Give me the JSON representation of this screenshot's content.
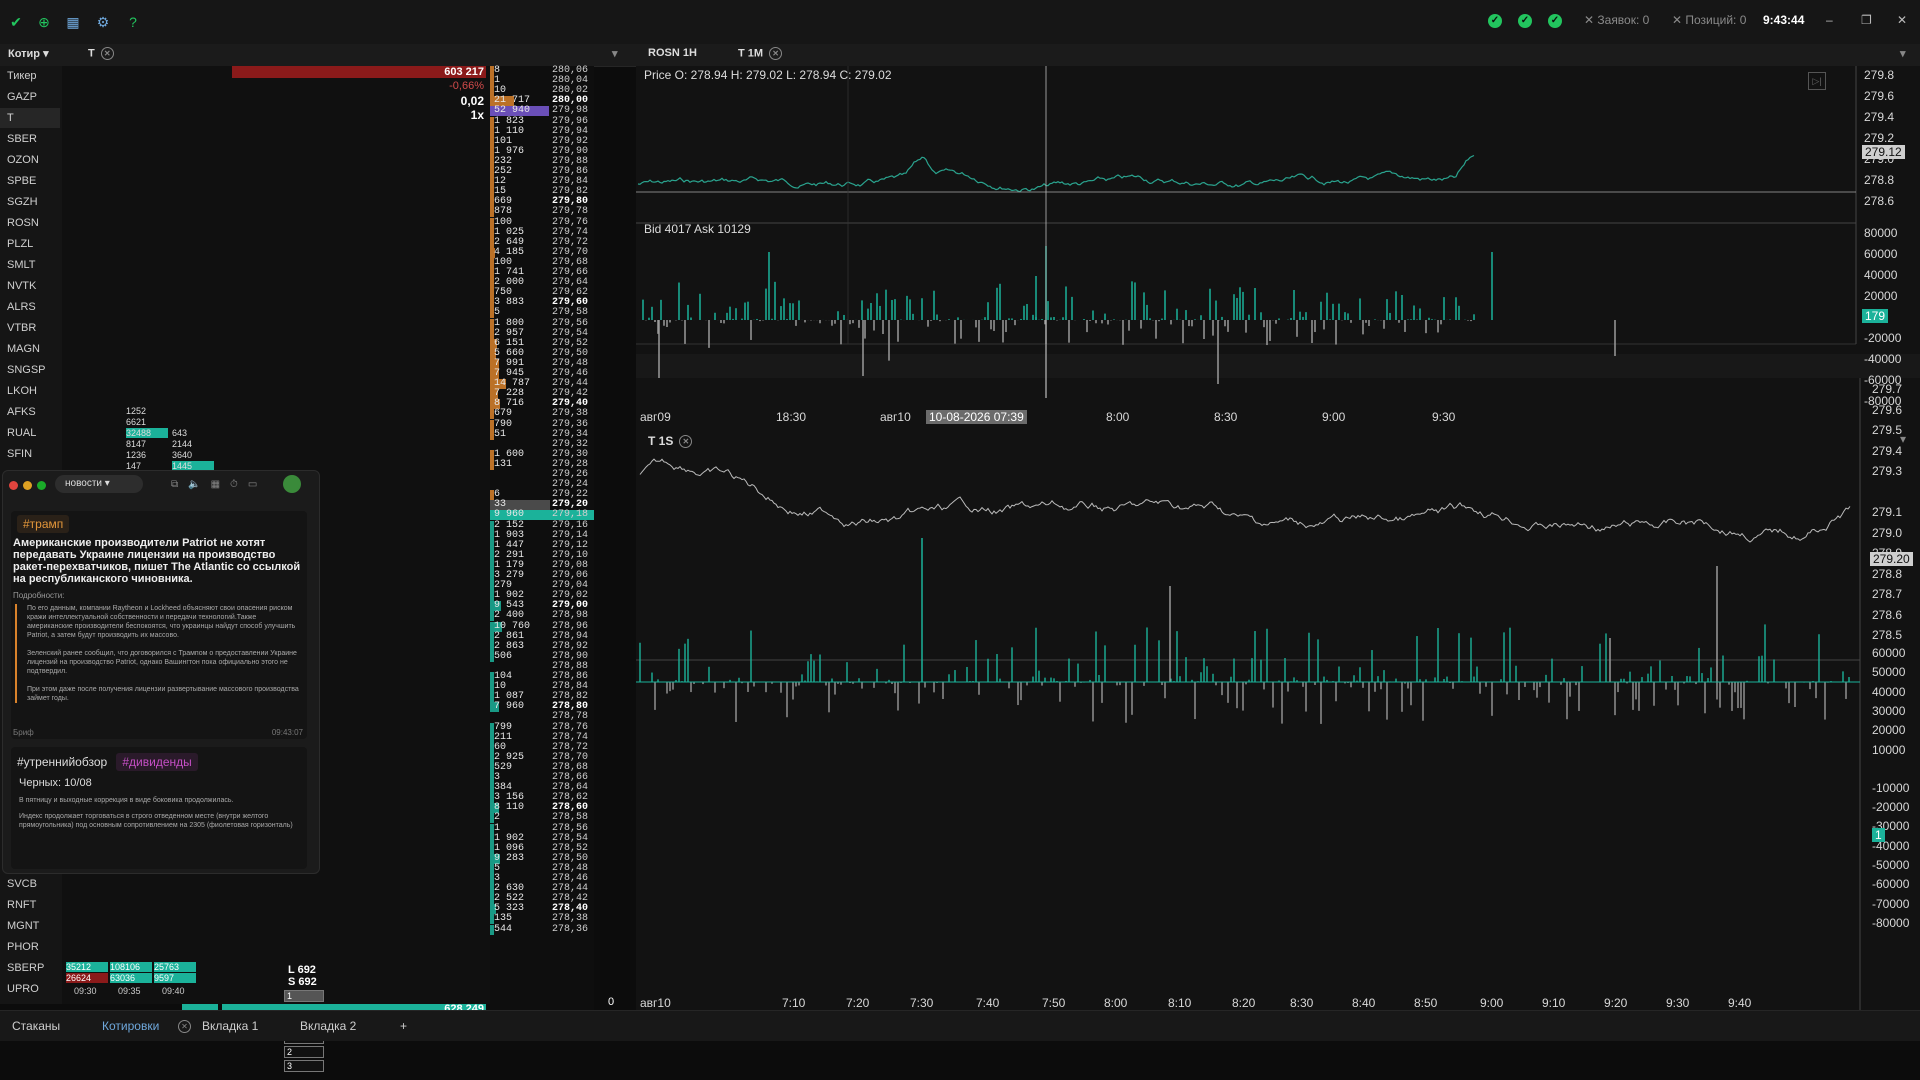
{
  "topbar": {
    "zayavok": "Заявок: 0",
    "pozitsiy": "Позиций: 0",
    "time": "9:43:44"
  },
  "left_panel": {
    "dropdown": "Котир",
    "ticker_tab": "T",
    "tickers": [
      "Тикер",
      "GAZP",
      "T",
      "SBER",
      "OZON",
      "SPBE",
      "SGZH",
      "ROSN",
      "PLZL",
      "SMLT",
      "NVTK",
      "ALRS",
      "VTBR",
      "MAGN",
      "SNGSP",
      "LKOH",
      "AFKS",
      "RUAL",
      "SFIN"
    ],
    "tickers_bottom": [
      "SVCB",
      "RNFT",
      "MGNT",
      "PHOR",
      "SBERP",
      "UPRO"
    ],
    "selected": "T"
  },
  "tape": {
    "top_volume": "603 217",
    "change": "-0,66%",
    "step": "0,02",
    "mult": "1x",
    "mini": [
      [
        "1252",
        ""
      ],
      [
        "6621",
        ""
      ],
      [
        "32488",
        "643"
      ],
      [
        "8147",
        "2144"
      ],
      [
        "1236",
        "3640"
      ],
      [
        "147",
        "1445"
      ]
    ],
    "L": "L 692",
    "S": "S 692",
    "qty": [
      "1",
      "1",
      "1",
      "2",
      "2",
      "3"
    ],
    "bottom_cells": [
      [
        "35212",
        "108106",
        "25763"
      ],
      [
        "26624",
        "63036",
        "9597"
      ]
    ],
    "bottom_times": [
      "09:30",
      "09:35",
      "09:40"
    ],
    "bottom_volume": "628 249",
    "zero": "0"
  },
  "news": {
    "tab": "новости",
    "tag1": "#трамп",
    "headline": "Американские производители Patriot не хотят передавать Украине лицензии на производство ракет-перехватчиков, пишет The Atlantic со ссылкой на республиканского чиновника.",
    "details": "Подробности:",
    "p1": "По его данным, компании Raytheon и Lockheed объясняют свои опасения риском кражи интеллектуальной собственности и передачи технологий.Также американские производители беспокоятся, что украинцы найдут способ улучшить Patriot, а затем будут производить их массово.",
    "p2": "Зеленский ранее сообщил, что договорился с Трампом о предоставлении Украине лицензий на производство Patriot, однако Вашингтон пока официально этого не подтвердил.",
    "p3": "При этом даже после получения лицензии развертывание массового производства займет годы.",
    "footer_left": "Бриф",
    "footer_time": "09:43:07",
    "tag2": "#утреннийобзор",
    "tag3": "#дивиденды",
    "sub": "Черных: 10/08",
    "line1": "В пятницу и выходные коррекция в виде боковика продолжилась.",
    "line2": "Индекс продолжает торговаться в строго отведенном месте (внутри желтого прямоугольника) под основным сопротивлением на 2305 (фиолетовая горизонталь)"
  },
  "book": [
    [
      "8",
      "280,06"
    ],
    [
      "1",
      "280,04"
    ],
    [
      "10",
      "280,02"
    ],
    [
      "21 717",
      "280,00"
    ],
    [
      "52 940",
      "279,98"
    ],
    [
      "1 823",
      "279,96"
    ],
    [
      "1 110",
      "279,94"
    ],
    [
      "101",
      "279,92"
    ],
    [
      "1 976",
      "279,90"
    ],
    [
      "232",
      "279,88"
    ],
    [
      "252",
      "279,86"
    ],
    [
      "12",
      "279,84"
    ],
    [
      "15",
      "279,82"
    ],
    [
      "669",
      "279,80"
    ],
    [
      "878",
      "279,78"
    ],
    [
      "100",
      "279,76"
    ],
    [
      "1 025",
      "279,74"
    ],
    [
      "2 649",
      "279,72"
    ],
    [
      "4 185",
      "279,70"
    ],
    [
      "100",
      "279,68"
    ],
    [
      "1 741",
      "279,66"
    ],
    [
      "2 000",
      "279,64"
    ],
    [
      "750",
      "279,62"
    ],
    [
      "3 883",
      "279,60"
    ],
    [
      "5",
      "279,58"
    ],
    [
      "1 800",
      "279,56"
    ],
    [
      "2 957",
      "279,54"
    ],
    [
      "6 151",
      "279,52"
    ],
    [
      "5 660",
      "279,50"
    ],
    [
      "7 991",
      "279,48"
    ],
    [
      "7 945",
      "279,46"
    ],
    [
      "14 787",
      "279,44"
    ],
    [
      "7 228",
      "279,42"
    ],
    [
      "8 716",
      "279,40"
    ],
    [
      "679",
      "279,38"
    ],
    [
      "790",
      "279,36"
    ],
    [
      "51",
      "279,34"
    ],
    [
      "",
      "279,32"
    ],
    [
      "1 600",
      "279,30"
    ],
    [
      "131",
      "279,28"
    ],
    [
      "",
      "279,26"
    ],
    [
      "",
      "279,24"
    ],
    [
      "6",
      "279,22"
    ],
    [
      "33",
      "279,20"
    ],
    [
      "9 960",
      "279,18"
    ],
    [
      "2 152",
      "279,16"
    ],
    [
      "1 903",
      "279,14"
    ],
    [
      "1 447",
      "279,12"
    ],
    [
      "2 291",
      "279,10"
    ],
    [
      "1 179",
      "279,08"
    ],
    [
      "3 279",
      "279,06"
    ],
    [
      "279",
      "279,04"
    ],
    [
      "1 902",
      "279,02"
    ],
    [
      "9 543",
      "279,00"
    ],
    [
      "2 400",
      "278,98"
    ],
    [
      "10 760",
      "278,96"
    ],
    [
      "2 861",
      "278,94"
    ],
    [
      "2 863",
      "278,92"
    ],
    [
      "506",
      "278,90"
    ],
    [
      "",
      "278,88"
    ],
    [
      "104",
      "278,86"
    ],
    [
      "10",
      "278,84"
    ],
    [
      "1 087",
      "278,82"
    ],
    [
      "7 960",
      "278,80"
    ],
    [
      "",
      "278,78"
    ],
    [
      "799",
      "278,76"
    ],
    [
      "211",
      "278,74"
    ],
    [
      "60",
      "278,72"
    ],
    [
      "2 925",
      "278,70"
    ],
    [
      "529",
      "278,68"
    ],
    [
      "3",
      "278,66"
    ],
    [
      "384",
      "278,64"
    ],
    [
      "3 156",
      "278,62"
    ],
    [
      "8 110",
      "278,60"
    ],
    [
      "2",
      "278,58"
    ],
    [
      "1",
      "278,56"
    ],
    [
      "1 902",
      "278,54"
    ],
    [
      "1 096",
      "278,52"
    ],
    [
      "9 283",
      "278,50"
    ],
    [
      "5",
      "278,48"
    ],
    [
      "3",
      "278,46"
    ],
    [
      "2 630",
      "278,44"
    ],
    [
      "2 522",
      "278,42"
    ],
    [
      "5 323",
      "278,40"
    ],
    [
      "135",
      "278,38"
    ],
    [
      "544",
      "278,36"
    ]
  ],
  "chart_top": {
    "tabs": [
      "ROSN 1H",
      "T 1M"
    ],
    "ohlc": "Price O: 278.94 H: 279.02 L: 278.94 C: 279.02",
    "bidask": "Bid 4017 Ask 10129",
    "price_ticks": [
      "279.8",
      "279.6",
      "279.4",
      "279.2",
      "279.0",
      "278.8",
      "278.6"
    ],
    "price_flag": "279.12",
    "vol_ticks": [
      "80000",
      "60000",
      "40000",
      "20000",
      "-20000",
      "-40000",
      "-60000",
      "-80000"
    ],
    "vol_flag": "179",
    "time_ticks": [
      "авг09",
      "18:30",
      "авг10",
      "8:00",
      "8:30",
      "9:00",
      "9:30"
    ],
    "cursor_time": "10-08-2026 07:39"
  },
  "chart_bottom": {
    "tab": "T 1S",
    "price_ticks": [
      "279.7",
      "279.6",
      "279.5",
      "279.4",
      "279.3",
      "279.1",
      "279.0",
      "278.9",
      "278.8",
      "278.7",
      "278.6",
      "278.5"
    ],
    "price_flag": "279.20",
    "vol_ticks": [
      "60000",
      "50000",
      "40000",
      "30000",
      "20000",
      "10000",
      "-10000",
      "-20000",
      "-30000",
      "-40000",
      "-50000",
      "-60000",
      "-70000",
      "-80000"
    ],
    "vol_flag": "1",
    "time_ticks": [
      "авг10",
      "7:10",
      "7:20",
      "7:30",
      "7:40",
      "7:50",
      "8:00",
      "8:10",
      "8:20",
      "8:30",
      "8:40",
      "8:50",
      "9:00",
      "9:10",
      "9:20",
      "9:30",
      "9:40"
    ]
  },
  "bottom_tabs": [
    "Стаканы",
    "Котировки",
    "Вкладка 1",
    "Вкладка 2",
    "+"
  ],
  "colors": {
    "green": "#22c55e",
    "teal": "#1bb29a",
    "orange": "#d9822b",
    "red": "#8b1a1a",
    "purple": "#7a5bd6"
  }
}
